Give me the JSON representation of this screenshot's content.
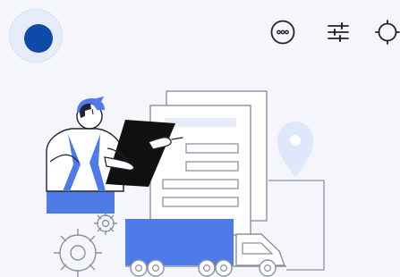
{
  "header": {
    "avatar_icon": "user-avatar",
    "more_icon": "more-icon",
    "filters_icon": "filters-icon",
    "theme_icon": "theme-icon"
  },
  "colors": {
    "background": "#f4f6fb",
    "avatar_ring": "#e7edf8",
    "avatar_fill": "#0f4aa8",
    "accent_blue": "#4f7be9",
    "icon_stroke": "#1f2430",
    "illustration_stroke": "#8c919e",
    "paper": "#ffffff",
    "pin_fill": "#dfe8fb"
  }
}
